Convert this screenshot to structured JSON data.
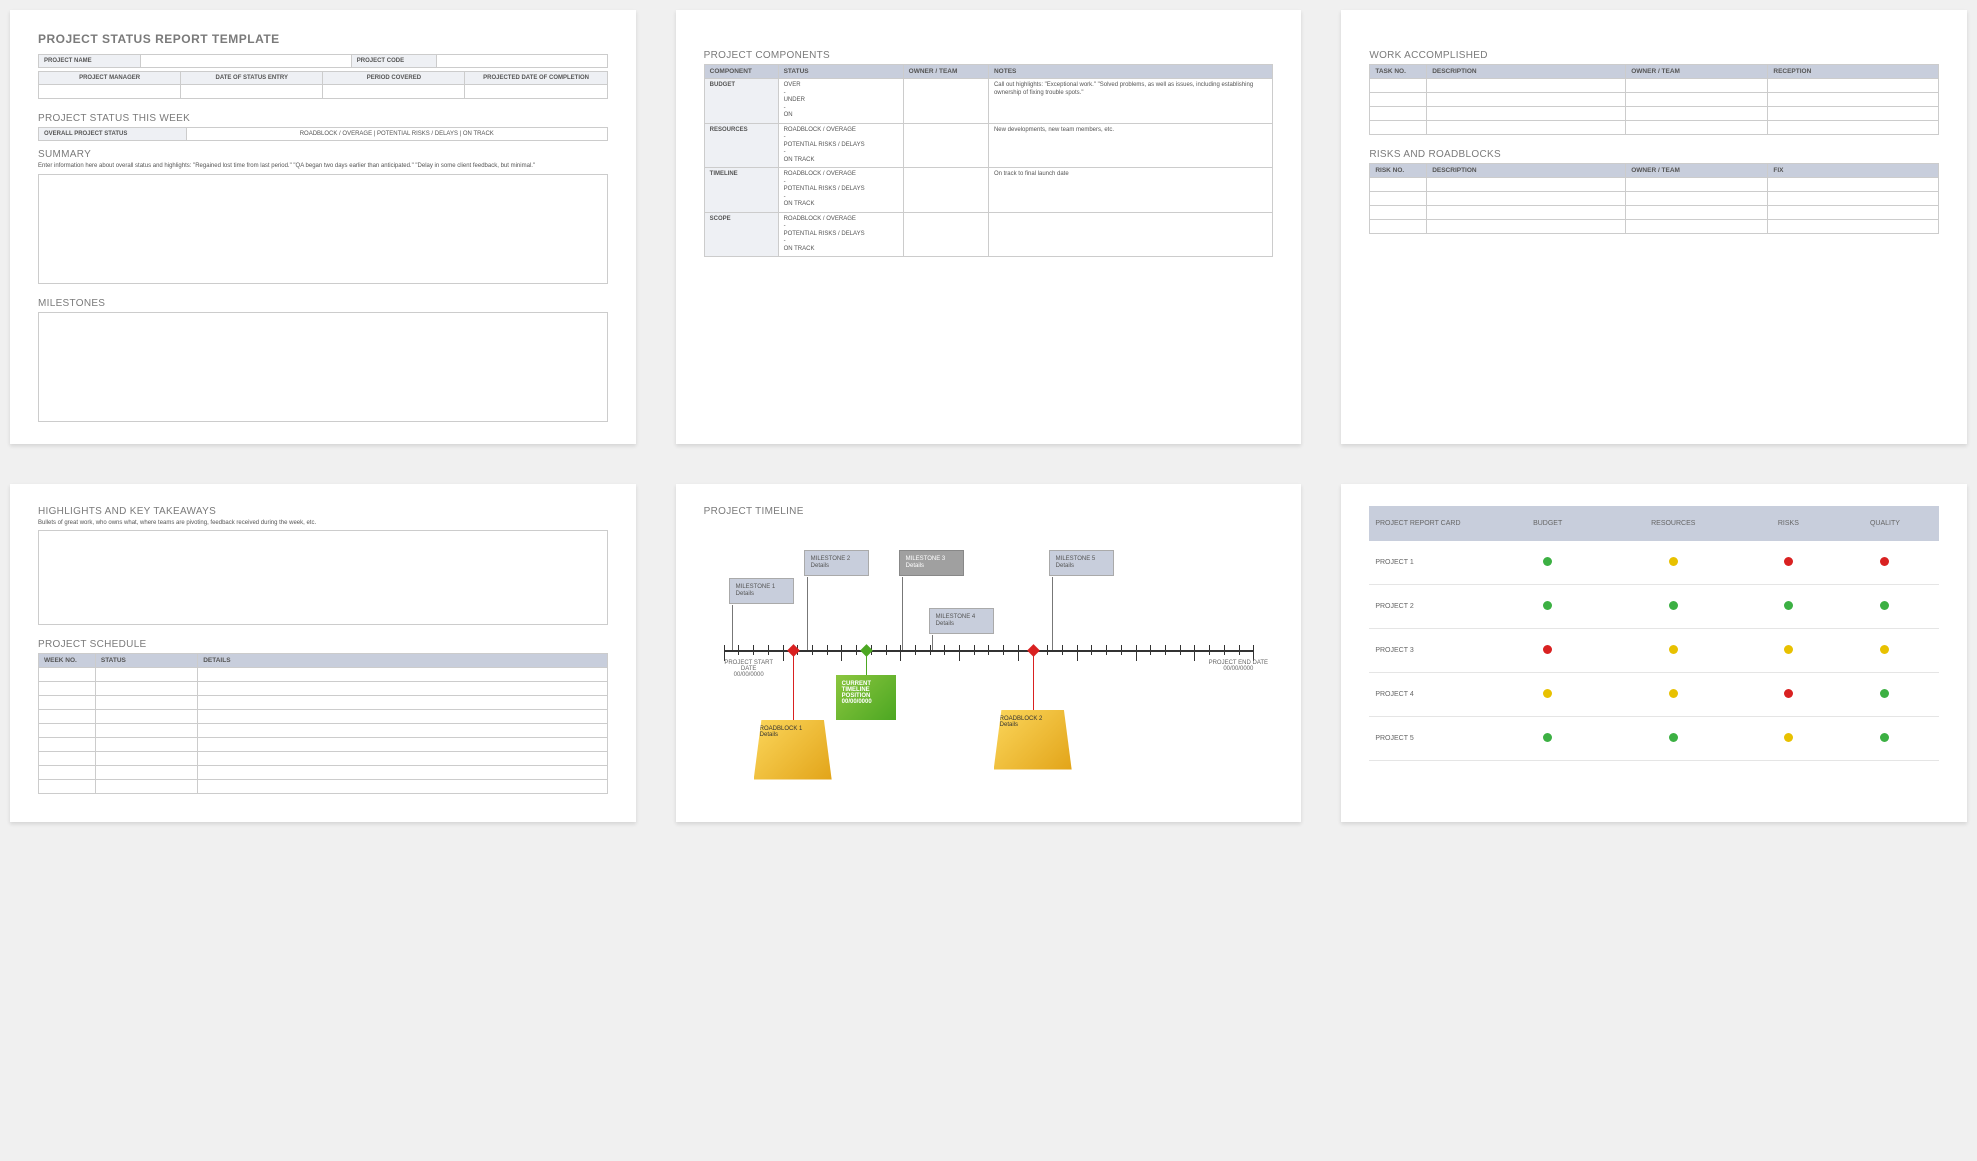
{
  "page1": {
    "title": "PROJECT STATUS REPORT TEMPLATE",
    "row1": {
      "c1": "PROJECT NAME",
      "c2": "PROJECT CODE"
    },
    "row2": {
      "c1": "PROJECT MANAGER",
      "c2": "DATE OF STATUS ENTRY",
      "c3": "PERIOD COVERED",
      "c4": "PROJECTED DATE OF COMPLETION"
    },
    "status_week": "PROJECT STATUS THIS WEEK",
    "overall": "OVERALL PROJECT STATUS",
    "pills": "ROADBLOCK / OVERAGE   |   POTENTIAL RISKS / DELAYS   |   ON TRACK",
    "summary_h": "SUMMARY",
    "summary_hint": "Enter information here about overall status and highlights: \"Regained lost time from last period.\" \"QA began two days earlier than anticipated.\" \"Delay in some client feedback, but minimal.\"",
    "milestones_h": "MILESTONES"
  },
  "page2": {
    "title": "PROJECT COMPONENTS",
    "headers": [
      "COMPONENT",
      "STATUS",
      "OWNER / TEAM",
      "NOTES"
    ],
    "rows": [
      {
        "c": "BUDGET",
        "s": "OVER\n-\nUNDER\n-\nON",
        "n": "Call out highlights: \"Exceptional work.\" \"Solved problems, as well as issues, including establishing ownership of fixing trouble spots.\""
      },
      {
        "c": "RESOURCES",
        "s": "ROADBLOCK / OVERAGE\n-\nPOTENTIAL RISKS / DELAYS\n-\nON TRACK",
        "n": "New developments, new team members, etc."
      },
      {
        "c": "TIMELINE",
        "s": "ROADBLOCK / OVERAGE\n-\nPOTENTIAL RISKS / DELAYS\n-\nON TRACK",
        "n": "On track to final launch date"
      },
      {
        "c": "SCOPE",
        "s": "ROADBLOCK / OVERAGE\n-\nPOTENTIAL RISKS / DELAYS\n-\nON TRACK",
        "n": ""
      }
    ]
  },
  "page3": {
    "work_h": "WORK ACCOMPLISHED",
    "work_headers": [
      "TASK NO.",
      "DESCRIPTION",
      "OWNER / TEAM",
      "RECEPTION"
    ],
    "risk_h": "RISKS AND ROADBLOCKS",
    "risk_headers": [
      "RISK NO.",
      "DESCRIPTION",
      "OWNER / TEAM",
      "FIX"
    ]
  },
  "page4": {
    "high_h": "HIGHLIGHTS AND KEY TAKEAWAYS",
    "high_hint": "Bullets of great work, who owns what, where teams are pivoting, feedback received during the week, etc.",
    "sched_h": "PROJECT SCHEDULE",
    "sched_headers": [
      "WEEK NO.",
      "STATUS",
      "DETAILS"
    ]
  },
  "page5": {
    "title": "PROJECT TIMELINE",
    "start": "PROJECT START DATE\n00/00/0000",
    "end": "PROJECT END DATE\n00/00/0000",
    "m1": "MILESTONE 1\nDetails",
    "m2": "MILESTONE 2\nDetails",
    "m3": "MILESTONE 3\nDetails",
    "m4": "MILESTONE 4\nDetails",
    "m5": "MILESTONE 5\nDetails",
    "current": "CURRENT TIMELINE POSITION 00/00/0000",
    "r1": "ROADBLOCK 1\nDetails",
    "r2": "ROADBLOCK 2\nDetails"
  },
  "page6": {
    "headers": [
      "PROJECT REPORT CARD",
      "BUDGET",
      "RESOURCES",
      "RISKS",
      "QUALITY"
    ],
    "rows": [
      {
        "label": "PROJECT 1",
        "cells": [
          "green",
          "yellow",
          "red",
          "red"
        ]
      },
      {
        "label": "PROJECT 2",
        "cells": [
          "green",
          "green",
          "green",
          "green"
        ]
      },
      {
        "label": "PROJECT 3",
        "cells": [
          "red",
          "yellow",
          "yellow",
          "yellow"
        ]
      },
      {
        "label": "PROJECT 4",
        "cells": [
          "yellow",
          "yellow",
          "red",
          "green"
        ]
      },
      {
        "label": "PROJECT 5",
        "cells": [
          "green",
          "green",
          "yellow",
          "green"
        ]
      }
    ]
  }
}
